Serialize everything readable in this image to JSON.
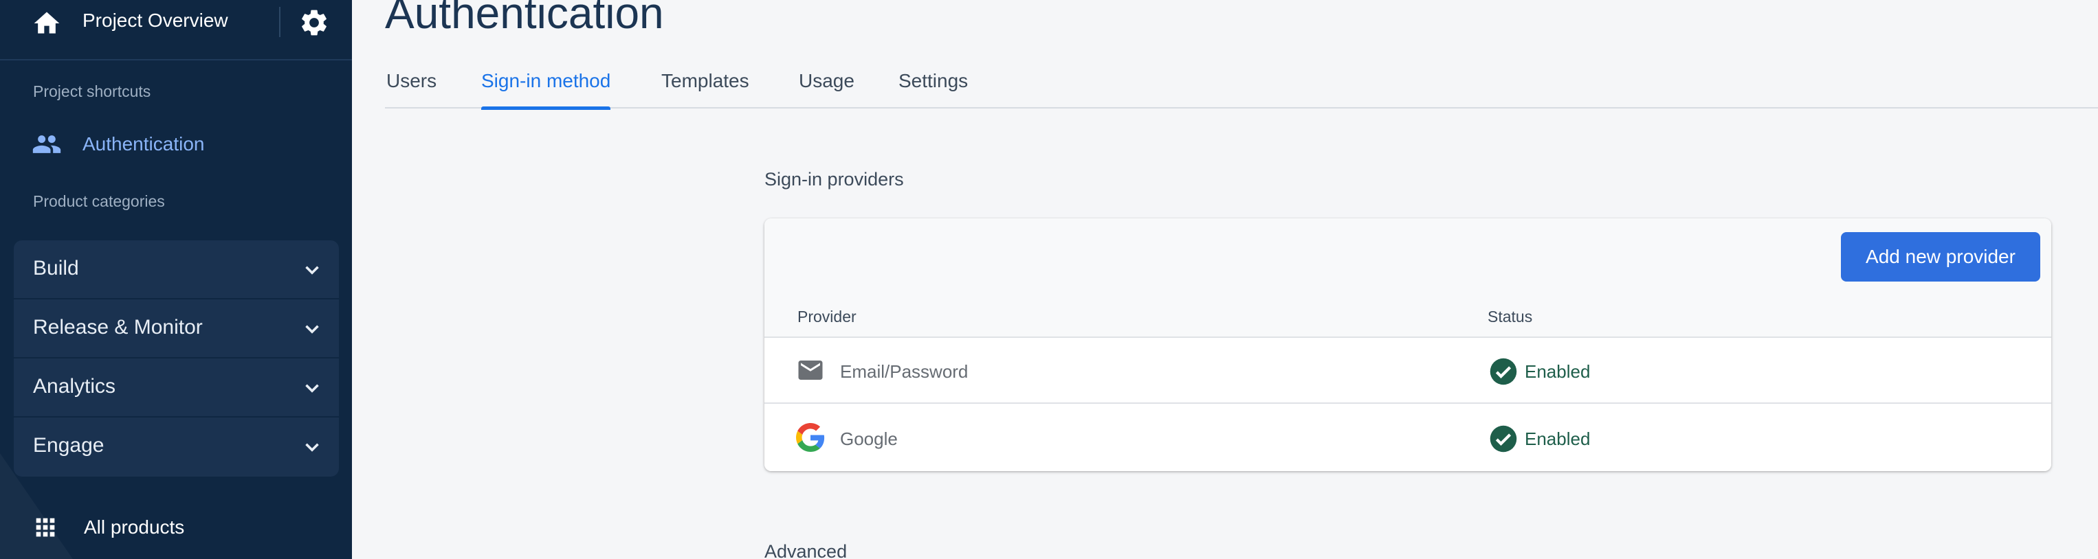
{
  "sidebar": {
    "title": "Project Overview",
    "shortcuts_label": "Project shortcuts",
    "shortcut_item": "Authentication",
    "categories_label": "Product categories",
    "categories": [
      "Build",
      "Release & Monitor",
      "Analytics",
      "Engage"
    ],
    "all_products": "All products"
  },
  "main": {
    "title": "Authentication",
    "tabs": [
      "Users",
      "Sign-in method",
      "Templates",
      "Usage",
      "Settings"
    ],
    "active_tab": "Sign-in method",
    "providers_title": "Sign-in providers",
    "add_button": "Add new provider",
    "columns": {
      "provider": "Provider",
      "status": "Status"
    },
    "rows": [
      {
        "provider": "Email/Password",
        "icon": "mail-icon",
        "status": "Enabled"
      },
      {
        "provider": "Google",
        "icon": "google-icon",
        "status": "Enabled"
      }
    ],
    "advanced_title": "Advanced"
  },
  "colors": {
    "sidebar_bg": "#0f2742",
    "accent": "#1a73e8",
    "button": "#2f6fde",
    "enabled": "#1e5e4a"
  }
}
